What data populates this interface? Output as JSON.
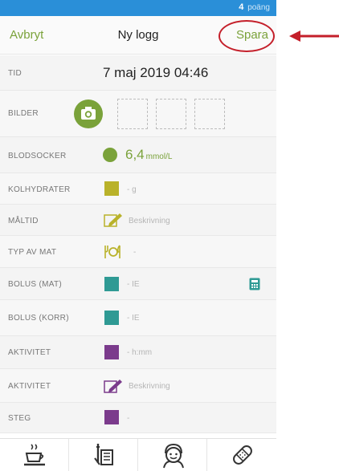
{
  "status": {
    "points_value": "4",
    "points_label": "poäng"
  },
  "nav": {
    "cancel_label": "Avbryt",
    "title": "Ny logg",
    "save_label": "Spara"
  },
  "rows": {
    "time": {
      "label": "TID",
      "value": "7 maj 2019 04:46"
    },
    "photos": {
      "label": "BILDER"
    },
    "glucose": {
      "label": "BLODSOCKER",
      "value": "6,4",
      "unit": "mmol/L"
    },
    "carbs": {
      "label": "KOLHYDRATER",
      "value": "- g"
    },
    "meal": {
      "label": "MÅLTID",
      "value": "Beskrivning"
    },
    "food_type": {
      "label": "TYP AV MAT",
      "value": "-"
    },
    "bolus_meal": {
      "label": "BOLUS (MAT)",
      "value": "- IE"
    },
    "bolus_corr": {
      "label": "BOLUS (KORR)",
      "value": "- IE"
    },
    "activity_time": {
      "label": "AKTIVITET",
      "value": "- h:mm"
    },
    "activity_desc": {
      "label": "AKTIVITET",
      "value": "Beskrivning"
    },
    "steps": {
      "label": "STEG",
      "value": "-"
    }
  },
  "colors": {
    "accent_green": "#7aa23a",
    "carbs_yellow": "#b9b22a",
    "bolus_teal": "#2f9a94",
    "activity_purple": "#7b3b8c",
    "status_blue": "#2a8fd8",
    "annotation_red": "#c41f2a"
  },
  "icons": {
    "camera": "camera-icon",
    "calculator": "calculator-icon",
    "food": "food-icon",
    "pencil": "pencil-icon",
    "coffee": "coffee-icon",
    "pen_book": "pen-book-icon",
    "avatar": "avatar-icon",
    "bandage": "bandage-icon"
  }
}
